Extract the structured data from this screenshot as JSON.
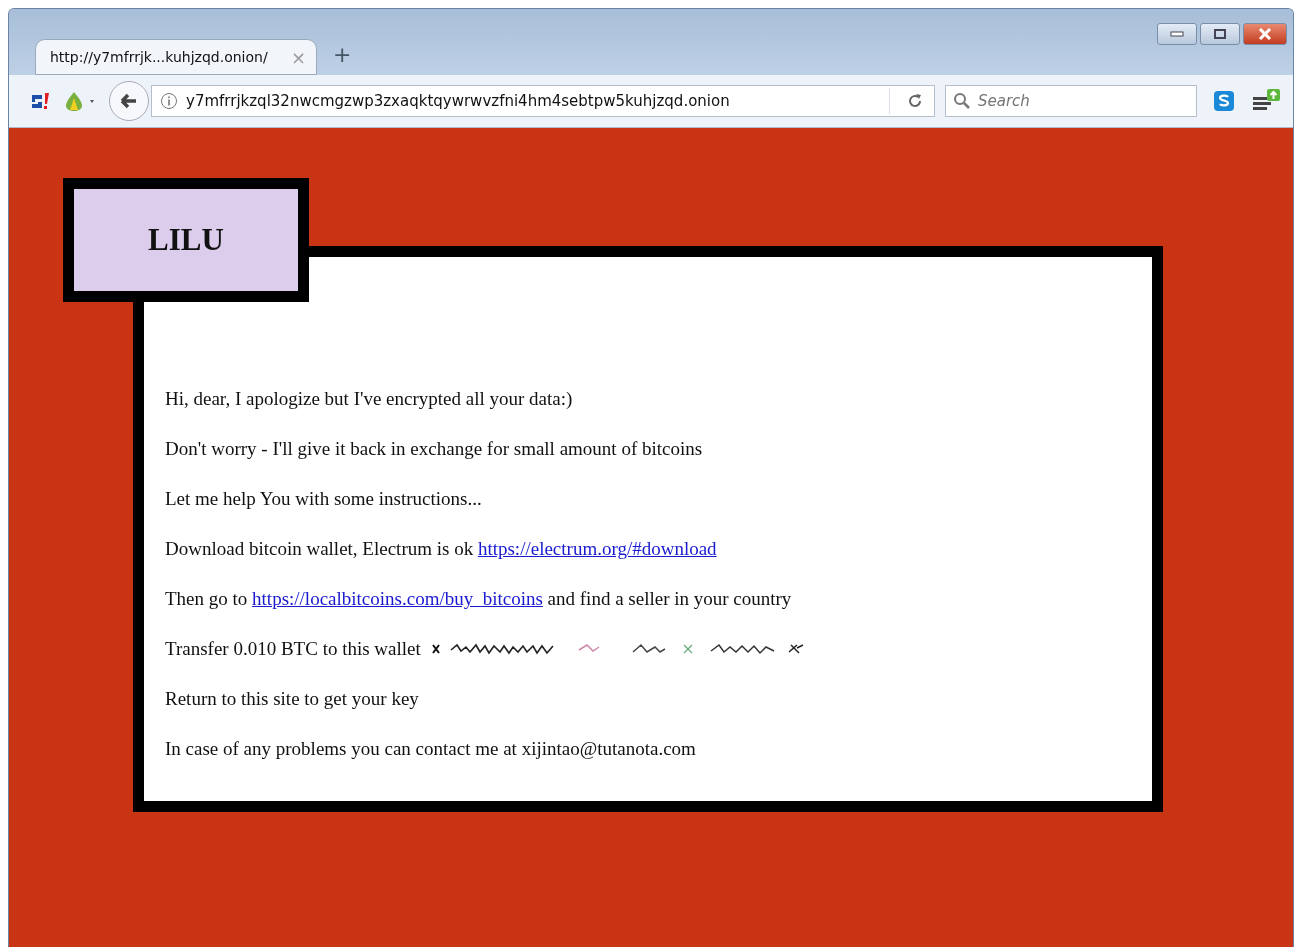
{
  "tab": {
    "title": "http://y7mfrrjk...kuhjzqd.onion/",
    "close": "×",
    "new_tab": "+"
  },
  "toolbar": {
    "url": "y7mfrrjkzql32nwcmgzwp3zxaqktqywrwvzfni4hm4sebtpw5kuhjzqd.onion",
    "search_placeholder": "Search"
  },
  "page": {
    "heading": "LILU",
    "lines": [
      {
        "kind": "text",
        "text": "Hi, dear, I apologize but I've encrypted all your data:)"
      },
      {
        "kind": "text",
        "text": "Don't worry - I'll give it back in exchange for small amount of bitcoins"
      },
      {
        "kind": "text",
        "text": "Let me help You with some instructions..."
      },
      {
        "kind": "link",
        "before": "Download bitcoin wallet, Electrum is ok ",
        "link": "https://electrum.org/#download"
      },
      {
        "kind": "link",
        "before": "Then go to ",
        "link": "https://localbitcoins.com/buy_bitcoins",
        "after": " and find a seller in your country"
      },
      {
        "kind": "wallet",
        "text": "Transfer 0.010 BTC to this wallet"
      },
      {
        "kind": "text",
        "text": "Return to this site to get your key"
      },
      {
        "kind": "text",
        "text": "In case of any problems you can contact me at xijintao@tutanota.com"
      }
    ]
  }
}
